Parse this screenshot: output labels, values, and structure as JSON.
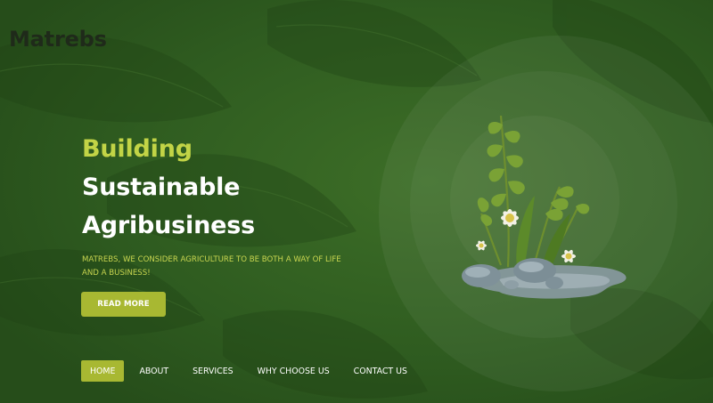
{
  "brand": {
    "name": "Matrebs"
  },
  "hero": {
    "line1": "Building",
    "line2": "Sustainable",
    "line3": "Agribusiness",
    "subtitle": "MATREBS, WE CONSIDER AGRICULTURE TO BE BOTH A WAY OF LIFE AND A BUSINESS!",
    "cta_label": "READ MORE"
  },
  "nav": {
    "items": [
      {
        "label": "HOME",
        "active": true
      },
      {
        "label": "ABOUT",
        "active": false
      },
      {
        "label": "SERVICES",
        "active": false
      },
      {
        "label": "WHY CHOOSE US",
        "active": false
      },
      {
        "label": "CONTACT US",
        "active": false
      }
    ]
  },
  "colors": {
    "background": "#2e5a1f",
    "accent": "#a8b832",
    "headline_accent": "#c2d446",
    "text": "#ffffff"
  },
  "icons": [
    "plant-illustration"
  ]
}
